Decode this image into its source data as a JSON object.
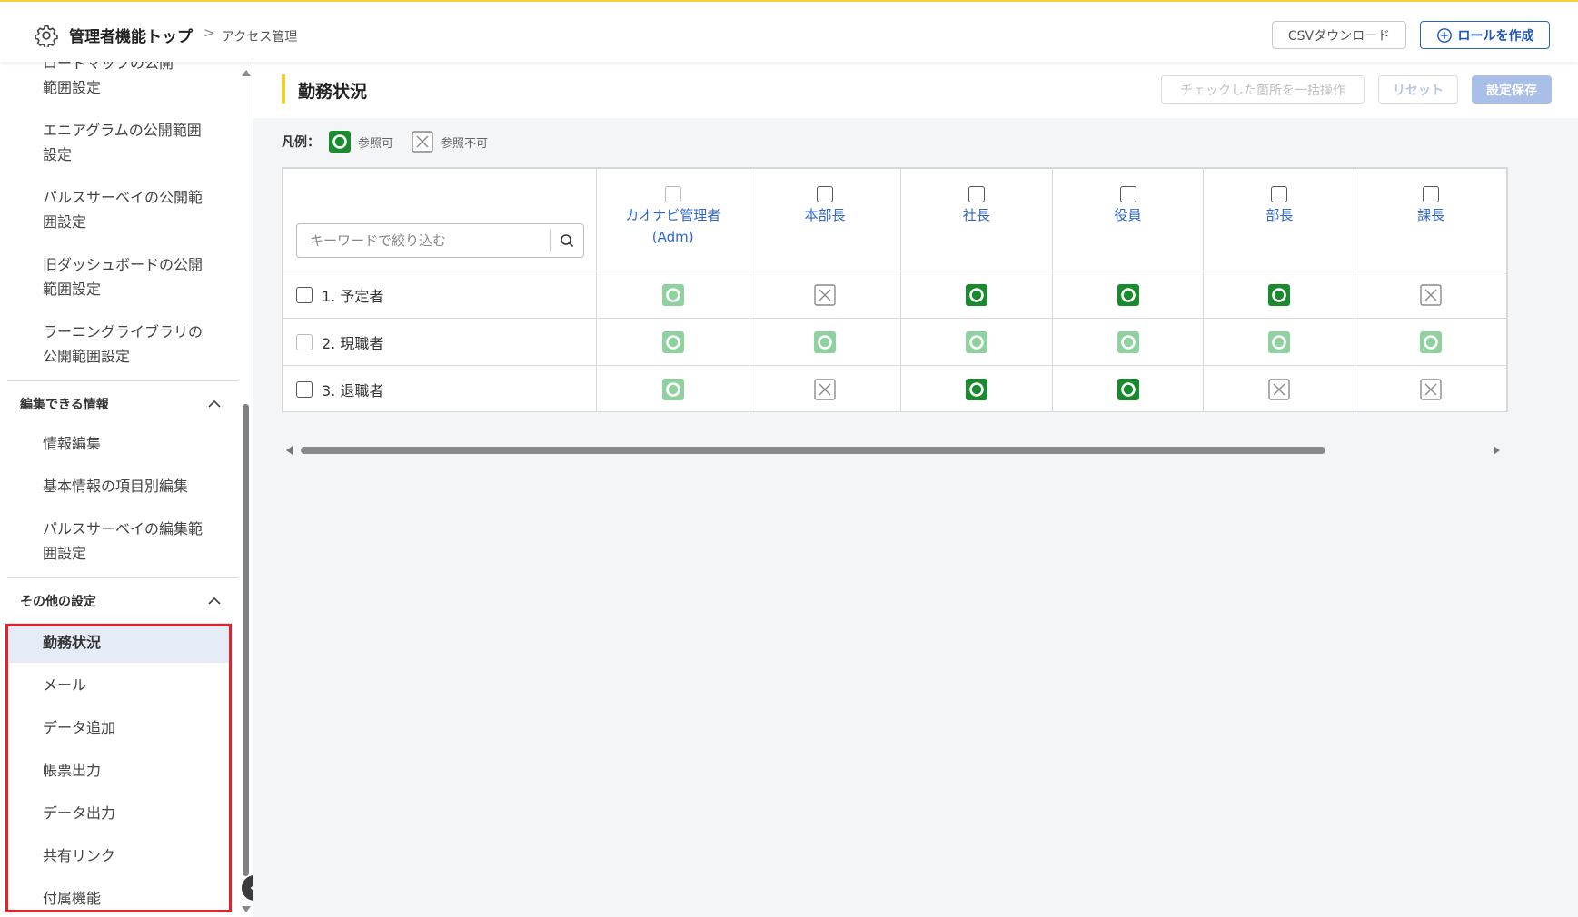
{
  "header": {
    "title": "管理者機能トップ",
    "breadcrumb_sep": ">",
    "breadcrumb": "アクセス管理",
    "csv_download_label": "CSVダウンロード",
    "create_role_label": "ロールを作成"
  },
  "sidebar": {
    "top_items": [
      "ロードマップの公開範囲設定",
      "エニアグラムの公開範囲設定",
      "パルスサーベイの公開範囲設定",
      "旧ダッシュボードの公開範囲設定",
      "ラーニングライブラリの公開範囲設定"
    ],
    "top_items_lines": [
      [
        "ロードマップの公開",
        "範囲設定"
      ],
      [
        "エニアグラムの公開範囲",
        "設定"
      ],
      [
        "パルスサーベイの公開範",
        "囲設定"
      ],
      [
        "旧ダッシュボードの公開",
        "範囲設定"
      ],
      [
        "ラーニングライブラリの",
        "公開範囲設定"
      ]
    ],
    "section_edit": {
      "title": "編集できる情報",
      "items": [
        "情報編集",
        "基本情報の項目別編集"
      ],
      "multi_line_item": [
        "パルスサーベイの編集範",
        "囲設定"
      ]
    },
    "section_other": {
      "title": "その他の設定",
      "items": [
        "勤務状況",
        "メール",
        "データ追加",
        "帳票出力",
        "データ出力",
        "共有リンク",
        "付属機能"
      ],
      "active_index": 0
    }
  },
  "main": {
    "page_title": "勤務状況",
    "bulk_action_label": "チェックした箇所を一括操作",
    "reset_label": "リセット",
    "save_label": "設定保存",
    "legend": {
      "label": "凡例：",
      "allowed_label": "参照可",
      "denied_label": "参照不可"
    },
    "search_placeholder": "キーワードで絞り込む",
    "roles": [
      {
        "name": "カオナビ管理者",
        "sub": "(Adm)",
        "checkbox_disabled": true
      },
      {
        "name": "本部長",
        "sub": "",
        "checkbox_disabled": false
      },
      {
        "name": "社長",
        "sub": "",
        "checkbox_disabled": false
      },
      {
        "name": "役員",
        "sub": "",
        "checkbox_disabled": false
      },
      {
        "name": "部長",
        "sub": "",
        "checkbox_disabled": false
      },
      {
        "name": "課長",
        "sub": "",
        "checkbox_disabled": false
      }
    ],
    "rows": [
      {
        "label": "1. 予定者",
        "checkbox_disabled": false,
        "cells": [
          "allowed-fixed",
          "denied",
          "allowed",
          "allowed",
          "allowed",
          "denied"
        ]
      },
      {
        "label": "2. 現職者",
        "checkbox_disabled": true,
        "cells": [
          "allowed-fixed",
          "allowed-fixed",
          "allowed-fixed",
          "allowed-fixed",
          "allowed-fixed",
          "allowed-fixed"
        ]
      },
      {
        "label": "3. 退職者",
        "checkbox_disabled": false,
        "cells": [
          "allowed-fixed",
          "denied",
          "allowed",
          "allowed",
          "denied",
          "denied"
        ]
      }
    ]
  },
  "colors": {
    "accent_yellow": "#f2cf2f",
    "primary_blue": "#1f56b8",
    "allowed_green": "#1a8a2e",
    "allowed_fixed_green": "#8fd2a0",
    "highlight_red": "#e5222b",
    "active_bg": "#e6ecf7"
  },
  "icons": {
    "settings": "gear-icon",
    "plus": "plus-circle-icon",
    "search": "search-icon",
    "collapse": "chevron-left-icon",
    "section_toggle": "chevron-up-icon"
  }
}
